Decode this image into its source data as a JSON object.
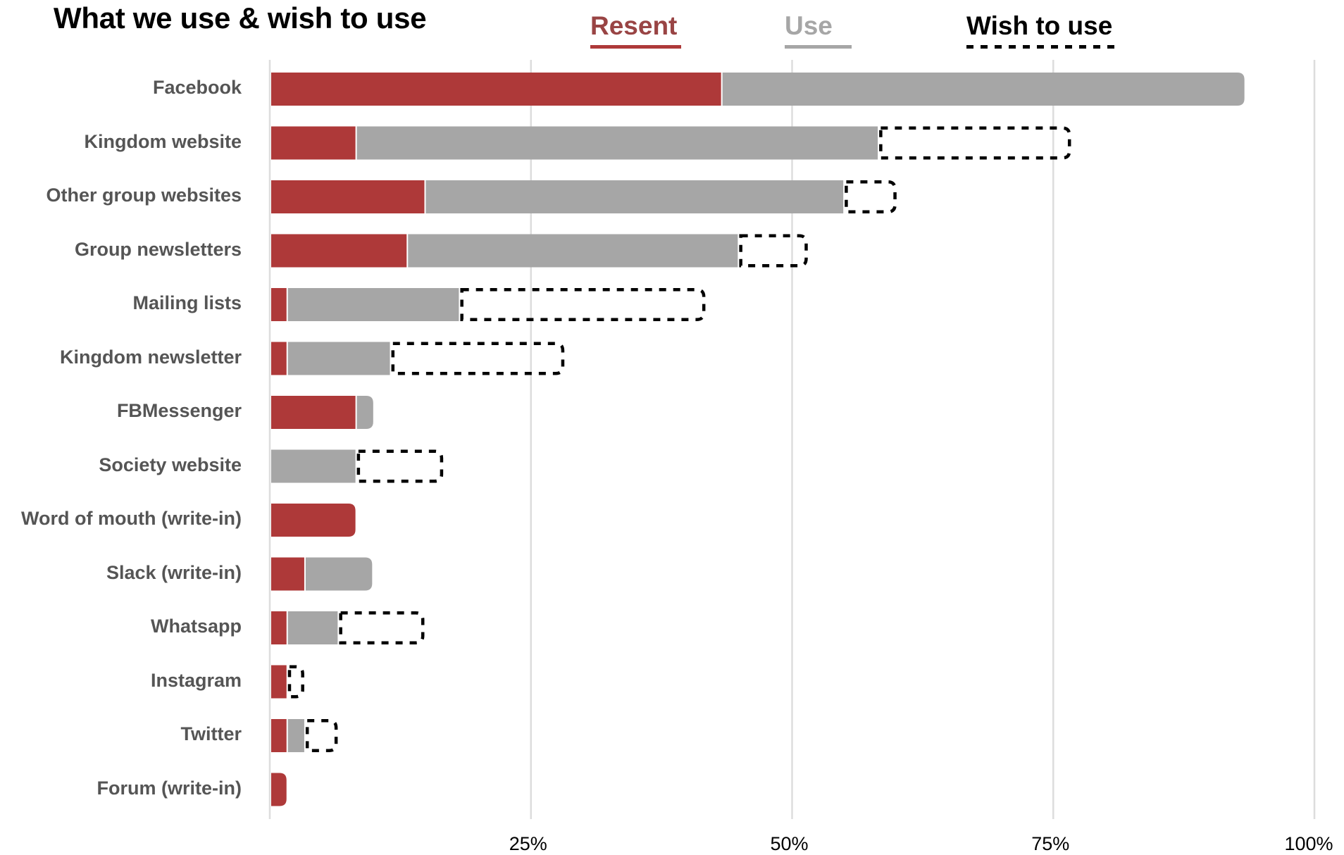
{
  "chart_data": {
    "type": "bar",
    "orientation": "horizontal",
    "stacked": true,
    "title": "What we use & wish to use",
    "xlabel": "",
    "ylabel": "",
    "xlim": [
      0,
      100
    ],
    "x_ticks": [
      {
        "value": 25,
        "label": "25%"
      },
      {
        "value": 50,
        "label": "50%"
      },
      {
        "value": 75,
        "label": "75%"
      },
      {
        "value": 100,
        "label": "100%"
      }
    ],
    "grid": true,
    "legend_position": "top",
    "legend": [
      {
        "key": "resent",
        "label": "Resent",
        "color": "#ae3939",
        "text_color": "#994444",
        "style": "solid"
      },
      {
        "key": "use",
        "label": "Use",
        "color": "#a6a6a6",
        "text_color": "#a6a6a6",
        "style": "solid"
      },
      {
        "key": "wish",
        "label": "Wish to use",
        "color": "#000000",
        "text_color": "#000000",
        "style": "dashed-outline"
      }
    ],
    "value_unit": "percent of respondents",
    "categories": [
      "Facebook",
      "Kingdom website",
      "Other group websites",
      "Group newsletters",
      "Mailing lists",
      "Kingdom newsletter",
      "FBMessenger",
      "Society website",
      "Word of mouth (write-in)",
      "Slack (write-in)",
      "Whatsapp",
      "Instagram",
      "Twitter",
      "Forum (write-in)"
    ],
    "series": [
      {
        "name": "Resent",
        "key": "resent",
        "values": [
          43.2,
          8.2,
          14.8,
          13.1,
          1.6,
          1.6,
          8.2,
          0,
          8.2,
          3.3,
          1.6,
          1.6,
          1.6,
          1.6
        ]
      },
      {
        "name": "Use",
        "key": "use",
        "values": [
          50.1,
          50.0,
          40.1,
          31.7,
          16.5,
          9.9,
          1.7,
          8.2,
          0,
          6.5,
          4.9,
          0,
          1.7,
          0
        ]
      },
      {
        "name": "Wish to use",
        "key": "wish",
        "values": [
          0,
          18.5,
          5.1,
          6.7,
          23.6,
          16.7,
          0,
          8.4,
          0,
          0,
          8.3,
          1.7,
          3.2,
          0
        ]
      }
    ]
  }
}
